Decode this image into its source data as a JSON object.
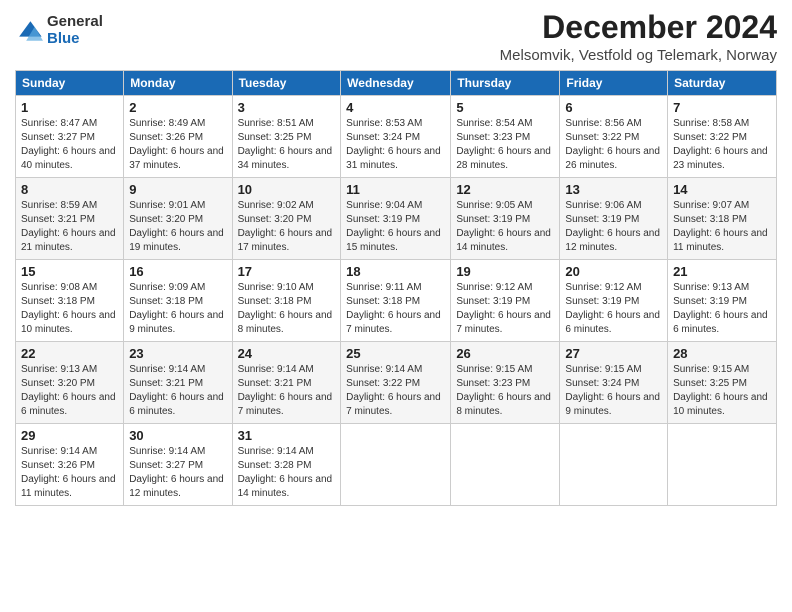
{
  "header": {
    "logo_general": "General",
    "logo_blue": "Blue",
    "month_title": "December 2024",
    "subtitle": "Melsomvik, Vestfold og Telemark, Norway"
  },
  "days_of_week": [
    "Sunday",
    "Monday",
    "Tuesday",
    "Wednesday",
    "Thursday",
    "Friday",
    "Saturday"
  ],
  "weeks": [
    [
      {
        "day": 1,
        "sunrise": "8:47 AM",
        "sunset": "3:27 PM",
        "daylight": "6 hours and 40 minutes."
      },
      {
        "day": 2,
        "sunrise": "8:49 AM",
        "sunset": "3:26 PM",
        "daylight": "6 hours and 37 minutes."
      },
      {
        "day": 3,
        "sunrise": "8:51 AM",
        "sunset": "3:25 PM",
        "daylight": "6 hours and 34 minutes."
      },
      {
        "day": 4,
        "sunrise": "8:53 AM",
        "sunset": "3:24 PM",
        "daylight": "6 hours and 31 minutes."
      },
      {
        "day": 5,
        "sunrise": "8:54 AM",
        "sunset": "3:23 PM",
        "daylight": "6 hours and 28 minutes."
      },
      {
        "day": 6,
        "sunrise": "8:56 AM",
        "sunset": "3:22 PM",
        "daylight": "6 hours and 26 minutes."
      },
      {
        "day": 7,
        "sunrise": "8:58 AM",
        "sunset": "3:22 PM",
        "daylight": "6 hours and 23 minutes."
      }
    ],
    [
      {
        "day": 8,
        "sunrise": "8:59 AM",
        "sunset": "3:21 PM",
        "daylight": "6 hours and 21 minutes."
      },
      {
        "day": 9,
        "sunrise": "9:01 AM",
        "sunset": "3:20 PM",
        "daylight": "6 hours and 19 minutes."
      },
      {
        "day": 10,
        "sunrise": "9:02 AM",
        "sunset": "3:20 PM",
        "daylight": "6 hours and 17 minutes."
      },
      {
        "day": 11,
        "sunrise": "9:04 AM",
        "sunset": "3:19 PM",
        "daylight": "6 hours and 15 minutes."
      },
      {
        "day": 12,
        "sunrise": "9:05 AM",
        "sunset": "3:19 PM",
        "daylight": "6 hours and 14 minutes."
      },
      {
        "day": 13,
        "sunrise": "9:06 AM",
        "sunset": "3:19 PM",
        "daylight": "6 hours and 12 minutes."
      },
      {
        "day": 14,
        "sunrise": "9:07 AM",
        "sunset": "3:18 PM",
        "daylight": "6 hours and 11 minutes."
      }
    ],
    [
      {
        "day": 15,
        "sunrise": "9:08 AM",
        "sunset": "3:18 PM",
        "daylight": "6 hours and 10 minutes."
      },
      {
        "day": 16,
        "sunrise": "9:09 AM",
        "sunset": "3:18 PM",
        "daylight": "6 hours and 9 minutes."
      },
      {
        "day": 17,
        "sunrise": "9:10 AM",
        "sunset": "3:18 PM",
        "daylight": "6 hours and 8 minutes."
      },
      {
        "day": 18,
        "sunrise": "9:11 AM",
        "sunset": "3:18 PM",
        "daylight": "6 hours and 7 minutes."
      },
      {
        "day": 19,
        "sunrise": "9:12 AM",
        "sunset": "3:19 PM",
        "daylight": "6 hours and 7 minutes."
      },
      {
        "day": 20,
        "sunrise": "9:12 AM",
        "sunset": "3:19 PM",
        "daylight": "6 hours and 6 minutes."
      },
      {
        "day": 21,
        "sunrise": "9:13 AM",
        "sunset": "3:19 PM",
        "daylight": "6 hours and 6 minutes."
      }
    ],
    [
      {
        "day": 22,
        "sunrise": "9:13 AM",
        "sunset": "3:20 PM",
        "daylight": "6 hours and 6 minutes."
      },
      {
        "day": 23,
        "sunrise": "9:14 AM",
        "sunset": "3:21 PM",
        "daylight": "6 hours and 6 minutes."
      },
      {
        "day": 24,
        "sunrise": "9:14 AM",
        "sunset": "3:21 PM",
        "daylight": "6 hours and 7 minutes."
      },
      {
        "day": 25,
        "sunrise": "9:14 AM",
        "sunset": "3:22 PM",
        "daylight": "6 hours and 7 minutes."
      },
      {
        "day": 26,
        "sunrise": "9:15 AM",
        "sunset": "3:23 PM",
        "daylight": "6 hours and 8 minutes."
      },
      {
        "day": 27,
        "sunrise": "9:15 AM",
        "sunset": "3:24 PM",
        "daylight": "6 hours and 9 minutes."
      },
      {
        "day": 28,
        "sunrise": "9:15 AM",
        "sunset": "3:25 PM",
        "daylight": "6 hours and 10 minutes."
      }
    ],
    [
      {
        "day": 29,
        "sunrise": "9:14 AM",
        "sunset": "3:26 PM",
        "daylight": "6 hours and 11 minutes."
      },
      {
        "day": 30,
        "sunrise": "9:14 AM",
        "sunset": "3:27 PM",
        "daylight": "6 hours and 12 minutes."
      },
      {
        "day": 31,
        "sunrise": "9:14 AM",
        "sunset": "3:28 PM",
        "daylight": "6 hours and 14 minutes."
      },
      null,
      null,
      null,
      null
    ]
  ]
}
